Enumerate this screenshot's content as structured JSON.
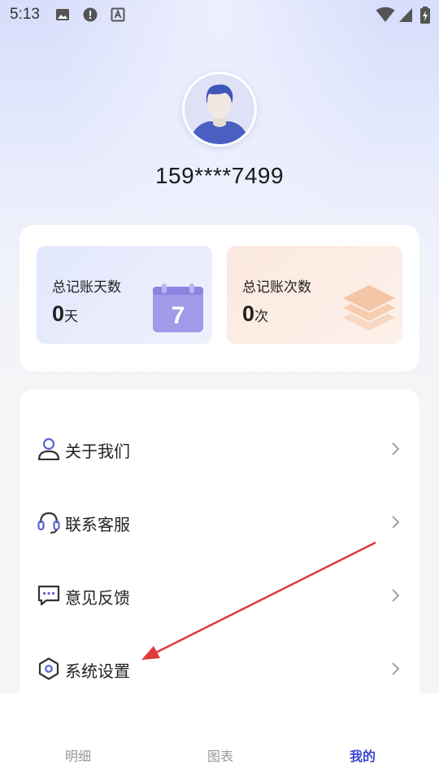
{
  "status_bar": {
    "time": "5:13",
    "left_icons": [
      "image-icon",
      "alert-icon",
      "keyboard-a-icon"
    ],
    "right_icons": [
      "wifi-icon",
      "signal-icon",
      "battery-charging-icon"
    ]
  },
  "profile": {
    "avatar_icon": "user-avatar",
    "phone": "159****7499"
  },
  "stats": {
    "days": {
      "label": "总记账天数",
      "value": "0",
      "unit": "天",
      "icon": "calendar-icon"
    },
    "count": {
      "label": "总记账次数",
      "value": "0",
      "unit": "次",
      "icon": "layers-icon"
    }
  },
  "menu": {
    "items": [
      {
        "label": "关于我们",
        "icon": "user-icon"
      },
      {
        "label": "联系客服",
        "icon": "headset-icon"
      },
      {
        "label": "意见反馈",
        "icon": "chat-icon"
      },
      {
        "label": "系统设置",
        "icon": "settings-icon"
      }
    ]
  },
  "bottom_nav": {
    "tabs": [
      {
        "label": "明细",
        "active": false
      },
      {
        "label": "图表",
        "active": false
      },
      {
        "label": "我的",
        "active": true
      }
    ]
  },
  "colors": {
    "accent": "#3a47d0",
    "annotation_arrow": "#e03a3a",
    "calendar": "#9a93ea",
    "layers": "#f6c9a9"
  }
}
